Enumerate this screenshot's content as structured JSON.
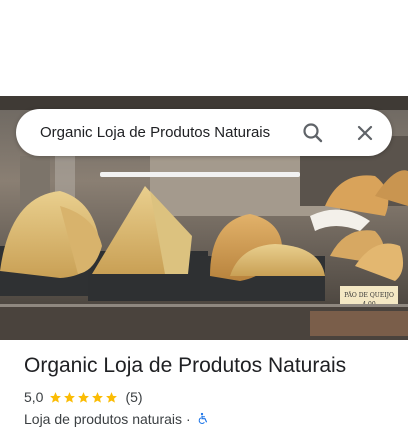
{
  "search": {
    "query": "Organic Loja de Produtos Naturais",
    "search_icon": "search-icon",
    "close_icon": "close-icon"
  },
  "photo": {
    "sign_line1": "PÃO DE QUEIJO",
    "sign_line2": "4,00"
  },
  "place": {
    "title": "Organic Loja de Produtos Naturais",
    "rating": "5,0",
    "stars": 5,
    "review_count": "(5)",
    "category": "Loja de produtos naturais",
    "separator": "·",
    "accessibility_icon": "wheelchair-accessible-icon"
  },
  "colors": {
    "star": "#fbbc04",
    "accessibility": "#1a73e8",
    "text_primary": "#202124",
    "text_secondary": "#3c4043"
  }
}
